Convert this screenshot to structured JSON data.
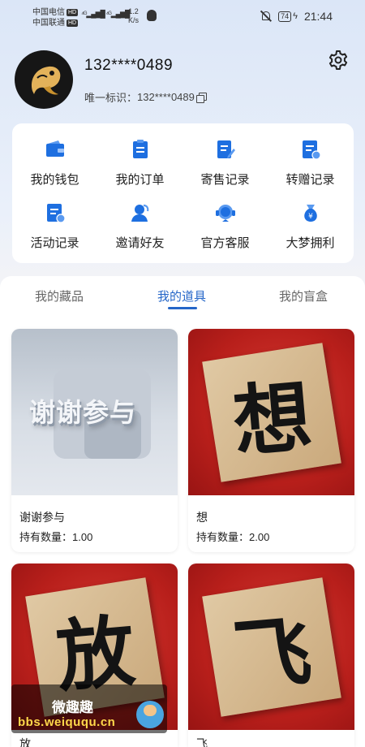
{
  "status_bar": {
    "carrier1": "中国电信",
    "carrier2": "中国联通",
    "hd": "HD",
    "net_speed_value": "1.2",
    "net_speed_unit": "K/s",
    "battery": "74",
    "time": "21:44"
  },
  "profile": {
    "username": "132****0489",
    "uid_label": "唯一标识：",
    "uid_value": "132****0489"
  },
  "menu": {
    "items": [
      {
        "label": "我的钱包",
        "icon": "wallet-icon"
      },
      {
        "label": "我的订单",
        "icon": "order-icon"
      },
      {
        "label": "寄售记录",
        "icon": "consignment-icon"
      },
      {
        "label": "转赠记录",
        "icon": "transfer-icon"
      },
      {
        "label": "活动记录",
        "icon": "activity-icon"
      },
      {
        "label": "邀请好友",
        "icon": "invite-icon"
      },
      {
        "label": "官方客服",
        "icon": "service-icon"
      },
      {
        "label": "大梦拥利",
        "icon": "money-bag-icon"
      }
    ],
    "accent": "#1e6fe0"
  },
  "tabs": {
    "items": [
      "我的藏品",
      "我的道具",
      "我的盲盒"
    ],
    "active_index": 1,
    "active_color": "#2566c8"
  },
  "cards": [
    {
      "image_text": "谢谢参与",
      "name": "谢谢参与",
      "qty_label": "持有数量：",
      "qty": "1.00"
    },
    {
      "image_text": "想",
      "name": "想",
      "qty_label": "持有数量：",
      "qty": "2.00"
    },
    {
      "image_text": "放",
      "name": "放",
      "qty_label": "",
      "qty": ""
    },
    {
      "image_text": "飞",
      "name": "飞",
      "qty_label": "",
      "qty": ""
    }
  ],
  "watermark": {
    "title": "微趣趣",
    "url": "bbs.weiququ.cn"
  }
}
